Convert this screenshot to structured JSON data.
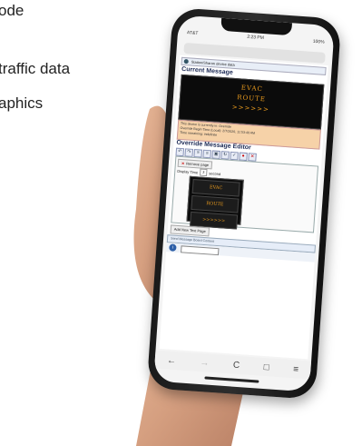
{
  "background_text": {
    "line1": "ode",
    "line2": "traffic data",
    "line3": "aphics"
  },
  "phone": {
    "status_time": "2:23 PM",
    "status_left": "AT&T",
    "status_right": "100%",
    "crumb": "Station/Sharon device data",
    "current_title": "Current Message",
    "sign_lines": [
      "EVAC",
      "ROUTE",
      ">>>>>>"
    ],
    "info_lines": [
      "This device is currently in: Override",
      "Override Begin Time (Local): 2/7/2020, 11:53:40 AM",
      "Time remaining: indefinite"
    ],
    "editor_title": "Override Message Editor",
    "toolbar_icons": [
      "undo-icon",
      "redo-icon",
      "align-left-icon",
      "align-right-icon",
      "image-icon",
      "refresh-icon",
      "check-icon",
      "stop-icon",
      "close-icon"
    ],
    "preview_label": "Remove page",
    "display_label": "Display Time",
    "display_value": "3",
    "display_unit": "second",
    "editor_lines": [
      "EVAC",
      "ROUTE",
      ">>>>>>"
    ],
    "add_label": "Add New Text Page",
    "panel_label": "Send Message Board Content",
    "nav_icons": [
      "←",
      "→",
      "C",
      "□",
      "≡"
    ]
  },
  "colors": {
    "sign_text": "#e89a1e",
    "info_bg": "#f6d2a8",
    "heading": "#1c2a55"
  }
}
